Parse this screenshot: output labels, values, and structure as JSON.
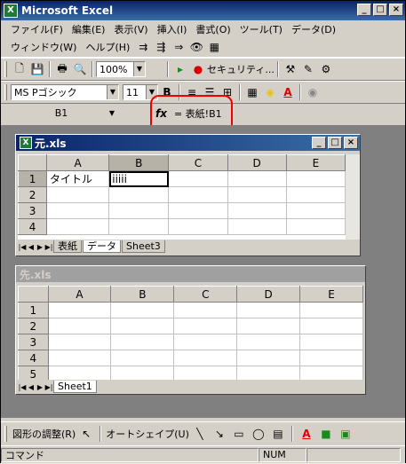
{
  "app": {
    "title": "Microsoft Excel",
    "win_min": "_",
    "win_max": "□",
    "win_close": "×"
  },
  "menu": {
    "row1": [
      "ファイル(F)",
      "編集(E)",
      "表示(V)",
      "挿入(I)",
      "書式(O)",
      "ツール(T)",
      "データ(D)"
    ],
    "row2": [
      "ウィンドウ(W)",
      "ヘルプ(H)"
    ]
  },
  "toolbar1": {
    "zoom": "100%",
    "security_label": "セキュリティ..."
  },
  "toolbar2": {
    "font_name": "MS Pゴシック",
    "font_size": "11",
    "bold": "B"
  },
  "formula_bar": {
    "name_box": "B1",
    "fx": "fx",
    "formula": "= 表紙!B1"
  },
  "doc1": {
    "title": "元.xls",
    "columns": [
      "A",
      "B",
      "C",
      "D",
      "E"
    ],
    "rows": [
      "1",
      "2",
      "3",
      "4"
    ],
    "cells": {
      "A1": "タイトル",
      "B1": "iiiii"
    },
    "tabs": [
      "表紙",
      "データ",
      "Sheet3"
    ]
  },
  "doc2": {
    "title": "先.xls",
    "columns": [
      "A",
      "B",
      "C",
      "D",
      "E"
    ],
    "rows": [
      "1",
      "2",
      "3",
      "4",
      "5"
    ],
    "tabs": [
      "Sheet1"
    ]
  },
  "drawbar": {
    "draw_label": "図形の調整(R)",
    "autoshape_label": "オートシェイプ(U)"
  },
  "status": {
    "mode": "コマンド",
    "num": "NUM"
  },
  "colors": {
    "callout": "#e00000",
    "title_active": "#0a246a"
  }
}
